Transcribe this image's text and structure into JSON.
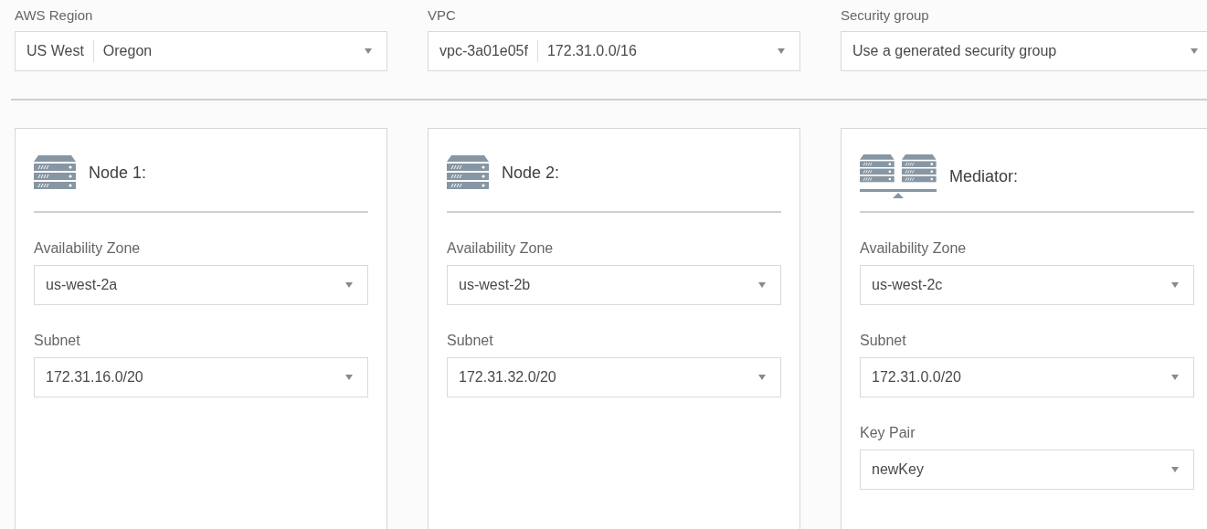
{
  "top_fields": [
    {
      "label": "AWS Region",
      "value_parts": [
        "US West",
        "Oregon"
      ]
    },
    {
      "label": "VPC",
      "value_parts": [
        "vpc-3a01e05f",
        "172.31.0.0/16"
      ]
    },
    {
      "label": "Security group",
      "value_parts": [
        "Use a generated security group"
      ]
    }
  ],
  "nodes": [
    {
      "kind": "server",
      "title": "Node 1:",
      "fields": [
        {
          "label": "Availability Zone",
          "value": "us-west-2a"
        },
        {
          "label": "Subnet",
          "value": "172.31.16.0/20"
        }
      ]
    },
    {
      "kind": "server",
      "title": "Node 2:",
      "fields": [
        {
          "label": "Availability Zone",
          "value": "us-west-2b"
        },
        {
          "label": "Subnet",
          "value": "172.31.32.0/20"
        }
      ]
    },
    {
      "kind": "mediator",
      "title": "Mediator:",
      "fields": [
        {
          "label": "Availability Zone",
          "value": "us-west-2c"
        },
        {
          "label": "Subnet",
          "value": "172.31.0.0/20"
        },
        {
          "label": "Key Pair",
          "value": "newKey"
        }
      ]
    }
  ]
}
